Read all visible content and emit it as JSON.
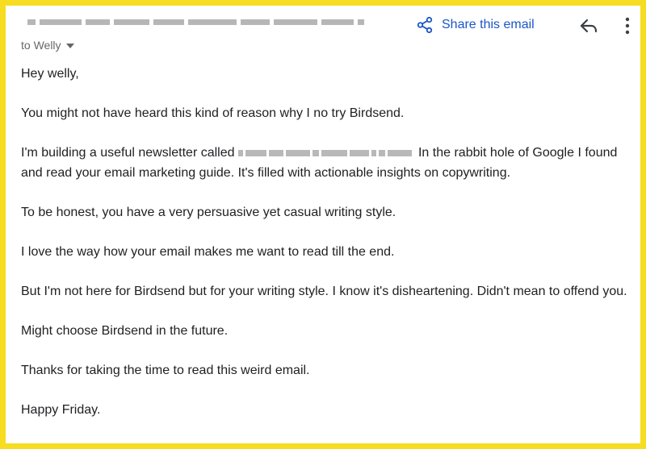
{
  "header": {
    "share_label": "Share this email",
    "to_label": "to Welly"
  },
  "icons": {
    "share": "share-icon",
    "reply": "reply-arrow-icon",
    "more": "more-vertical-icon",
    "caret": "caret-down-icon"
  },
  "body": {
    "greeting": "Hey welly,",
    "p1": "You might not have heard this kind of reason why I no try Birdsend.",
    "p2_start": "I'm building a useful newsletter called",
    "p2_end": "In the rabbit hole of Google I found and read your email marketing guide. It's filled with actionable insights on copywriting.",
    "p3": "To be honest, you have a very persuasive yet casual writing style.",
    "p4": "I love the way how your email makes me want to read till the end.",
    "p5": "But I'm not here for Birdsend but for your writing style. I know it's disheartening. Didn't mean to offend you.",
    "p6": "Might choose Birdsend in the future.",
    "p7": "Thanks for taking the time to read this weird email.",
    "p8": "Happy Friday."
  },
  "colors": {
    "frame": "#f7dd21",
    "link": "#1a57c7",
    "text": "#202124",
    "muted": "#666666"
  }
}
